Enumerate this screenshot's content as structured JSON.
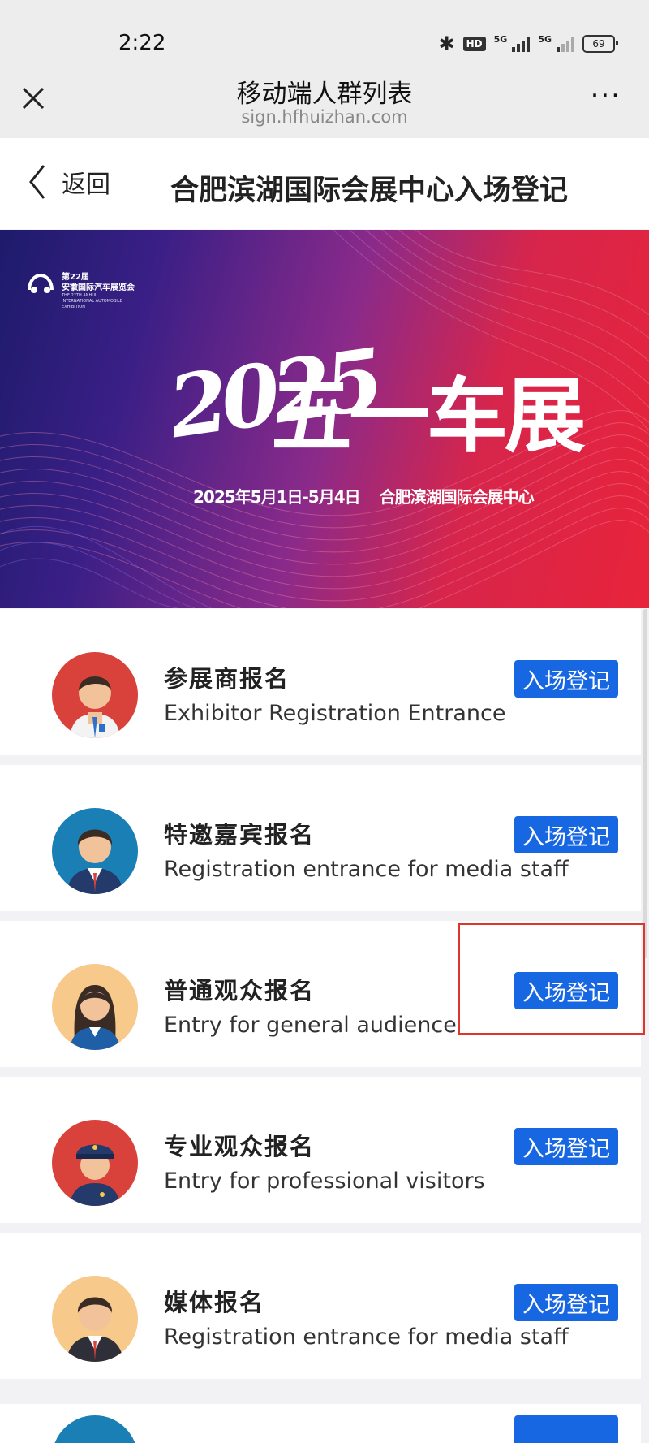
{
  "status_bar": {
    "time": "2:22",
    "hd_label": "HD",
    "network1": "5G",
    "network2": "5G",
    "battery": "69"
  },
  "nav": {
    "title": "移动端人群列表",
    "subtitle": "sign.hfhuizhan.com",
    "more": "···"
  },
  "header": {
    "back_label": "返回",
    "title": "合肥滨湖国际会展中心入场登记"
  },
  "banner": {
    "logo_line1": "第22届",
    "logo_line2": "安徽国际汽车展览会",
    "logo_en": "THE 22TH ANHUI INTERNATIONAL AUTOMOBILE EXHIBITION",
    "year": "2025",
    "title": "五一车展",
    "dates": "2025年5月1日-5月4日",
    "venue": "合肥滨湖国际会展中心"
  },
  "entries": [
    {
      "title": "参展商报名",
      "subtitle": "Exhibitor Registration Entrance",
      "button": "入场登记",
      "avatar_bg": "#d9423a"
    },
    {
      "title": "特邀嘉宾报名",
      "subtitle": "Registration entrance for media staff",
      "button": "入场登记",
      "avatar_bg": "#1a7fb5"
    },
    {
      "title": "普通观众报名",
      "subtitle": "Entry for general audience",
      "button": "入场登记",
      "avatar_bg": "#f7c98a"
    },
    {
      "title": "专业观众报名",
      "subtitle": "Entry for professional visitors",
      "button": "入场登记",
      "avatar_bg": "#d9423a"
    },
    {
      "title": "媒体报名",
      "subtitle": "Registration entrance for media staff",
      "button": "入场登记",
      "avatar_bg": "#f7c98a"
    }
  ],
  "colors": {
    "accent": "#1867e2",
    "highlight": "#e0352e"
  }
}
